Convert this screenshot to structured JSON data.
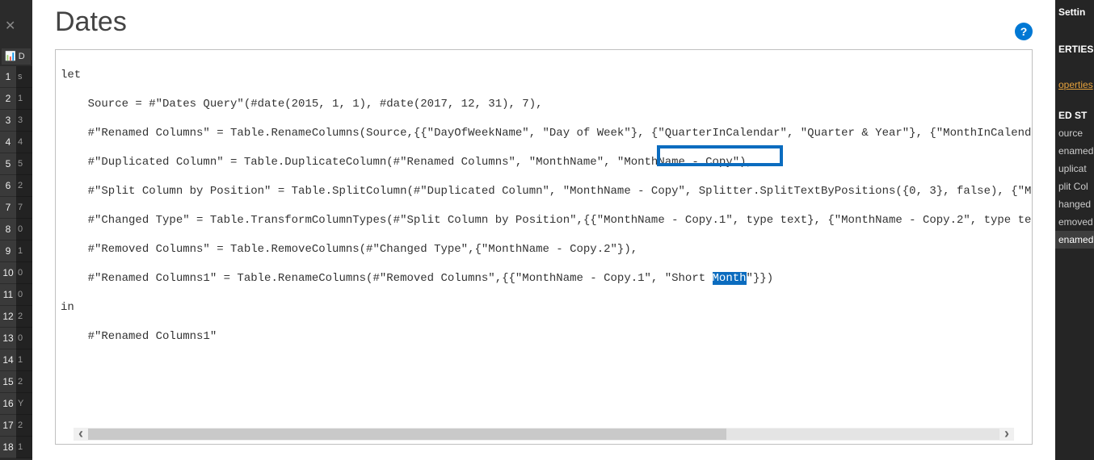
{
  "left": {
    "col_header": "D",
    "rows": [
      {
        "num": "1",
        "v": "s"
      },
      {
        "num": "2",
        "v": "1"
      },
      {
        "num": "3",
        "v": "3"
      },
      {
        "num": "4",
        "v": "4"
      },
      {
        "num": "5",
        "v": "5"
      },
      {
        "num": "6",
        "v": "2"
      },
      {
        "num": "7",
        "v": "7"
      },
      {
        "num": "8",
        "v": "0"
      },
      {
        "num": "9",
        "v": "1"
      },
      {
        "num": "10",
        "v": "0"
      },
      {
        "num": "11",
        "v": "0"
      },
      {
        "num": "12",
        "v": "2"
      },
      {
        "num": "13",
        "v": "0"
      },
      {
        "num": "14",
        "v": "1"
      },
      {
        "num": "15",
        "v": "2"
      },
      {
        "num": "16",
        "v": "Y"
      },
      {
        "num": "17",
        "v": "2"
      },
      {
        "num": "18",
        "v": "1"
      }
    ]
  },
  "title": "Dates",
  "code": {
    "l1": "let",
    "l2": "    Source = #\"Dates Query\"(#date(2015, 1, 1), #date(2017, 12, 31), 7),",
    "l3": "    #\"Renamed Columns\" = Table.RenameColumns(Source,{{\"DayOfWeekName\", \"Day of Week\"}, {\"QuarterInCalendar\", \"Quarter & Year\"}, {\"MonthInCalend",
    "l4": "    #\"Duplicated Column\" = Table.DuplicateColumn(#\"Renamed Columns\", \"MonthName\", \"MonthName - Copy\"),",
    "l5": "    #\"Split Column by Position\" = Table.SplitColumn(#\"Duplicated Column\", \"MonthName - Copy\", Splitter.SplitTextByPositions({0, 3}, false), {\"M",
    "l6": "    #\"Changed Type\" = Table.TransformColumnTypes(#\"Split Column by Position\",{{\"MonthName - Copy.1\", type text}, {\"MonthName - Copy.2\", type te",
    "l7": "    #\"Removed Columns\" = Table.RemoveColumns(#\"Changed Type\",{\"MonthName - Copy.2\"}),",
    "l8a": "    #\"Renamed Columns1\" = Table.RenameColumns(#\"Removed Columns\",{{\"MonthName - Copy.1\", \"Short ",
    "l8sel": "Month",
    "l8b": "\"}})",
    "l9": "in",
    "l10": "    #\"Renamed Columns1\""
  },
  "right": {
    "settings": "Settin",
    "properties": "ERTIES",
    "all_props_link": "operties",
    "applied": "ED ST",
    "steps": [
      "ource",
      "enamed",
      "uplicat",
      "plit Col",
      "hanged",
      "emoved",
      "enamed"
    ]
  },
  "help_glyph": "?",
  "scroll": {
    "left_glyph": "‹",
    "right_glyph": "›"
  }
}
